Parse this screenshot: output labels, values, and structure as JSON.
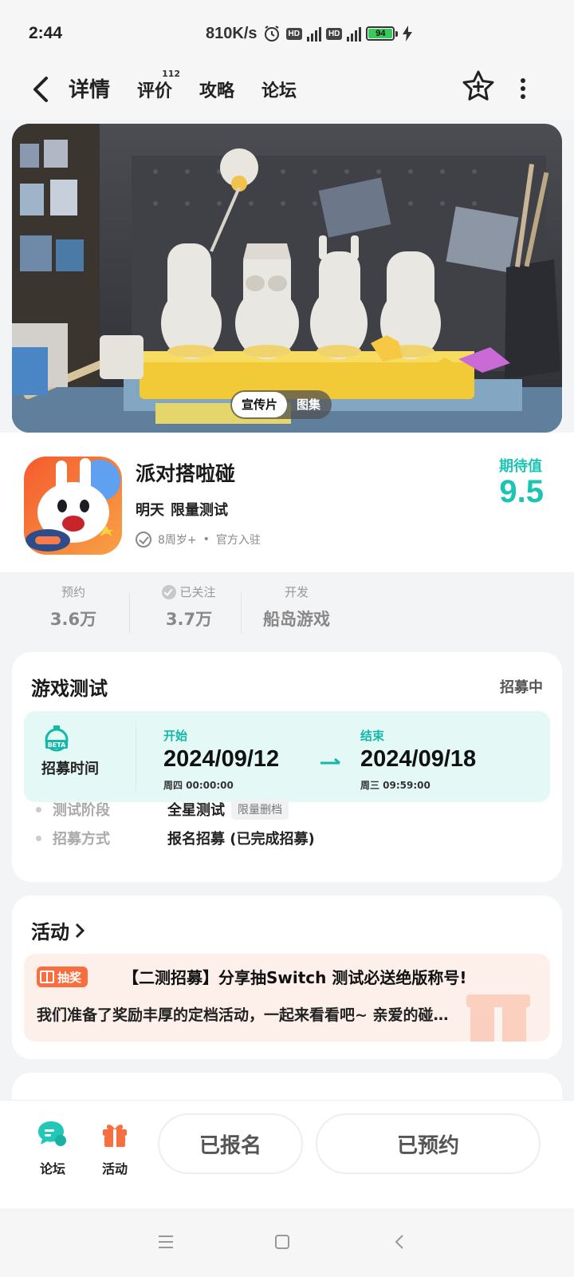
{
  "status": {
    "time": "2:44",
    "network_speed": "810K/s",
    "battery": "94"
  },
  "nav": {
    "tabs": [
      {
        "label": "详情",
        "badge": ""
      },
      {
        "label": "评价",
        "badge": "112"
      },
      {
        "label": "攻略",
        "badge": ""
      },
      {
        "label": "论坛",
        "badge": ""
      }
    ]
  },
  "hero": {
    "toggle": [
      "宣传片",
      "图集"
    ]
  },
  "app": {
    "name": "派对搭啦碰",
    "release": "明天",
    "test_type": "限量测试",
    "age": "8周岁+",
    "separator": "•",
    "official": "官方入驻",
    "expect_label": "期待值",
    "expect_value": "9.5"
  },
  "stats": [
    {
      "label": "预约",
      "value": "3.6万"
    },
    {
      "label": "已关注",
      "value": "3.7万"
    },
    {
      "label": "开发",
      "value": "船岛游戏"
    }
  ],
  "test": {
    "title": "游戏测试",
    "status": "招募中",
    "recruit_label": "招募时间",
    "start_label": "开始",
    "start_date": "2024/09/12",
    "start_time": "周四  00:00:00",
    "end_label": "结束",
    "end_date": "2024/09/18",
    "end_time": "周三  09:59:00",
    "stage_key": "测试阶段",
    "stage_value": "全星测试",
    "stage_tag": "限量删档",
    "method_key": "招募方式",
    "method_value": "报名招募 (已完成招募)"
  },
  "activity": {
    "title": "活动",
    "badge": "抽奖",
    "headline": "【二测招募】分享抽Switch 测试必送绝版称号!",
    "description": "我们准备了奖励丰厚的定档活动，一起来看看吧~ 亲爱的碰…"
  },
  "bottom": {
    "forum_label": "论坛",
    "activity_label": "活动",
    "signed_up": "已报名",
    "reserved": "已预约"
  },
  "colors": {
    "accent": "#1bc4b5",
    "orange": "#f86f3f"
  }
}
